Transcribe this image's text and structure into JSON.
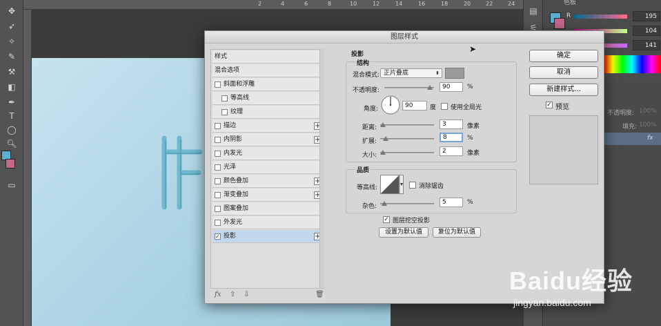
{
  "app": {
    "ruler_ticks": [
      "2",
      "4",
      "6",
      "8",
      "10",
      "12",
      "14",
      "16",
      "18",
      "20",
      "22",
      "24"
    ],
    "right_panel": {
      "top_tab": "色板",
      "color_rows": [
        {
          "letter": "R",
          "value": "195"
        },
        {
          "letter": "",
          "value": "104"
        },
        {
          "letter": "",
          "value": "141"
        }
      ],
      "layer_opacity_label": "不透明度:",
      "layer_opacity_value": "100%",
      "layer_fill_label": "填充:",
      "layer_fill_value": "100%",
      "fx_label": "fx"
    }
  },
  "dialog": {
    "title": "图层样式",
    "style_list": [
      {
        "label": "样式",
        "checkbox": false,
        "indent": false,
        "plus": false,
        "checked": false,
        "selected": false
      },
      {
        "label": "混合选项",
        "checkbox": false,
        "indent": false,
        "plus": false,
        "checked": false,
        "selected": false
      },
      {
        "label": "斜面和浮雕",
        "checkbox": true,
        "indent": false,
        "plus": false,
        "checked": false,
        "selected": false
      },
      {
        "label": "等高线",
        "checkbox": true,
        "indent": true,
        "plus": false,
        "checked": false,
        "selected": false
      },
      {
        "label": "纹理",
        "checkbox": true,
        "indent": true,
        "plus": false,
        "checked": false,
        "selected": false
      },
      {
        "label": "描边",
        "checkbox": true,
        "indent": false,
        "plus": true,
        "checked": false,
        "selected": false
      },
      {
        "label": "内阴影",
        "checkbox": true,
        "indent": false,
        "plus": true,
        "checked": false,
        "selected": false
      },
      {
        "label": "内发光",
        "checkbox": true,
        "indent": false,
        "plus": false,
        "checked": false,
        "selected": false
      },
      {
        "label": "光泽",
        "checkbox": true,
        "indent": false,
        "plus": false,
        "checked": false,
        "selected": false
      },
      {
        "label": "颜色叠加",
        "checkbox": true,
        "indent": false,
        "plus": true,
        "checked": false,
        "selected": false
      },
      {
        "label": "渐变叠加",
        "checkbox": true,
        "indent": false,
        "plus": true,
        "checked": false,
        "selected": false
      },
      {
        "label": "图案叠加",
        "checkbox": true,
        "indent": false,
        "plus": false,
        "checked": false,
        "selected": false
      },
      {
        "label": "外发光",
        "checkbox": true,
        "indent": false,
        "plus": false,
        "checked": false,
        "selected": false
      },
      {
        "label": "投影",
        "checkbox": true,
        "indent": false,
        "plus": true,
        "checked": true,
        "selected": true
      }
    ],
    "list_footer": {
      "fx": "fx",
      "up": "⇧",
      "down": "⇩",
      "trash": "🗑"
    },
    "settings": {
      "section_title": "投影",
      "structure_title": "结构",
      "blend_mode_label": "混合模式:",
      "blend_mode_value": "正片叠底",
      "swatch_color": "#9a9a9a",
      "opacity_label": "不透明度:",
      "opacity_value": "90",
      "opacity_unit": "%",
      "angle_label": "角度:",
      "angle_value": "90",
      "angle_unit": "度",
      "global_light_label": "使用全局光",
      "distance_label": "距离:",
      "distance_value": "3",
      "distance_unit": "像素",
      "spread_label": "扩展:",
      "spread_value": "8",
      "spread_unit": "%",
      "size_label": "大小:",
      "size_value": "2",
      "size_unit": "像素",
      "quality_title": "品质",
      "contour_label": "等高线:",
      "antialias_label": "消除锯齿",
      "noise_label": "杂色:",
      "noise_value": "5",
      "noise_unit": "%",
      "knockout_label": "图层挖空投影",
      "set_default_label": "设置为默认值",
      "reset_default_label": "复位为默认值"
    },
    "buttons": {
      "ok": "确定",
      "cancel": "取消",
      "new_style": "新建样式...",
      "preview": "预览"
    }
  },
  "watermark": {
    "main": "Baidu经验",
    "sub": "jingyan.baidu.com"
  }
}
